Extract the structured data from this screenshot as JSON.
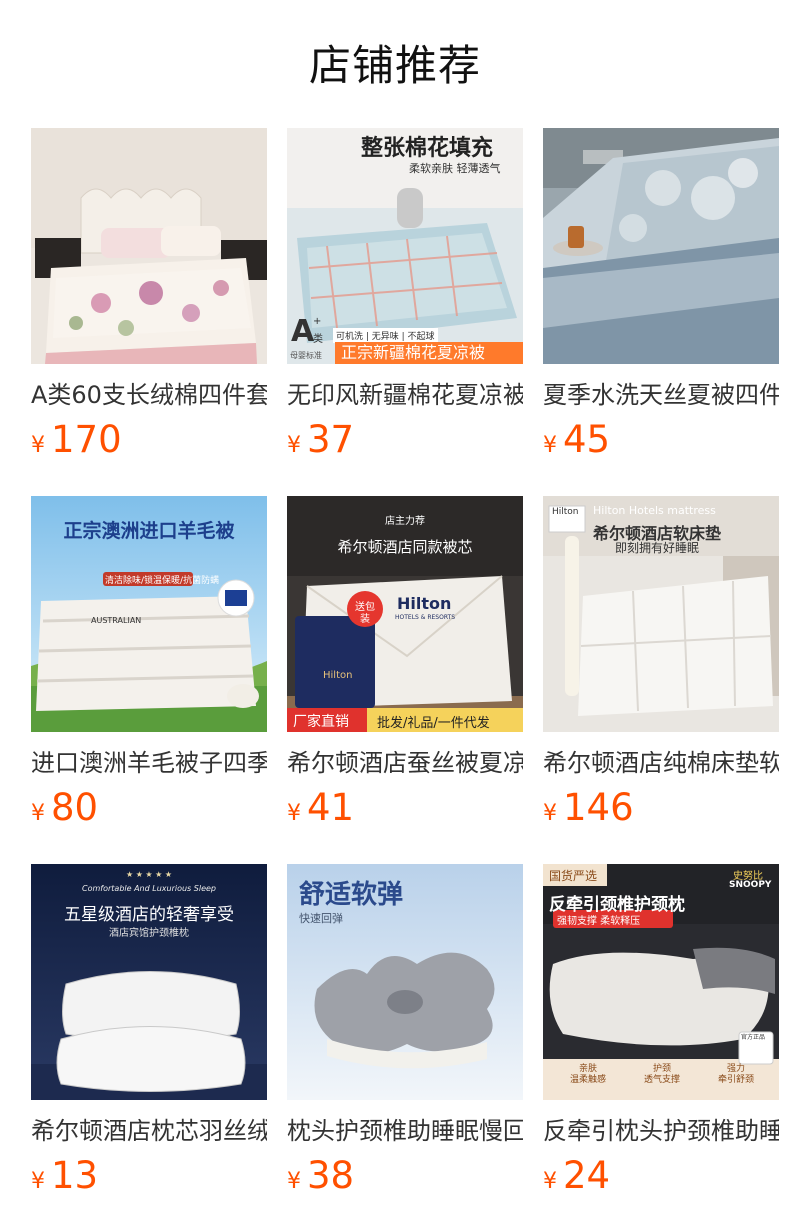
{
  "title": "店铺推荐",
  "currency_symbol": "¥",
  "colors": {
    "price": "#ff5000",
    "title": "#111111"
  },
  "products": [
    {
      "title": "A类60支长绒棉四件套",
      "price": "170",
      "image": {}
    },
    {
      "title": "无印风新疆棉花夏凉被",
      "price": "37",
      "image": {
        "headline": "整张棉花填充",
        "sub": "柔软亲肤  轻薄透气",
        "badge_letter": "A",
        "badge_sup": "+",
        "badge_cls": "类",
        "badge_note": "母婴标准",
        "tags": "可机洗 | 无异味 | 不起球",
        "banner": "正宗新疆棉花夏凉被"
      }
    },
    {
      "title": "夏季水洗天丝夏被四件套",
      "price": "45",
      "image": {}
    },
    {
      "title": "进口澳洲羊毛被子四季",
      "price": "80",
      "image": {
        "headline": "正宗澳洲进口羊毛被",
        "sub": "清洁除味/锁温保暖/抗菌防螨",
        "brand": "AUSTRALIAN"
      }
    },
    {
      "title": "希尔顿酒店蚕丝被夏凉被",
      "price": "41",
      "image": {
        "top": "店主力荐",
        "headline": "希尔顿酒店同款被芯",
        "brand": "Hilton",
        "brand_sub": "HOTELS & RESORTS",
        "bag_brand": "Hilton",
        "gift": "送包装",
        "tag_left": "厂家直销",
        "tag_right": "批发/礼品/一件代发"
      }
    },
    {
      "title": "希尔顿酒店纯棉床垫软垫",
      "price": "146",
      "image": {
        "logo": "Hilton",
        "en": "Hilton Hotels mattress",
        "headline": "希尔顿酒店软床垫",
        "sub": "即刻拥有好睡眠"
      }
    },
    {
      "title": "希尔顿酒店枕芯羽丝绒枕",
      "price": "13",
      "image": {
        "stars": "★ ★ ★ ★ ★",
        "script": "Comfortable And Luxurious Sleep",
        "headline": "五星级酒店的轻奢享受",
        "sub": "酒店宾馆护颈椎枕"
      }
    },
    {
      "title": "枕头护颈椎助睡眠慢回弹",
      "price": "38",
      "image": {
        "headline": "舒适软弹",
        "sub": "快速回弹"
      }
    },
    {
      "title": "反牵引枕头护颈椎助睡眠",
      "price": "24",
      "image": {
        "badge": "国货严选",
        "brand": "史努比",
        "brand_en": "SNOOPY",
        "headline": "反牵引颈椎护颈枕",
        "sub": "强韧支撑 柔软释压",
        "store": "官方正品",
        "features": [
          "亲肤\n温柔触感",
          "护颈\n透气支撑",
          "强力\n牵引舒颈"
        ]
      }
    }
  ]
}
